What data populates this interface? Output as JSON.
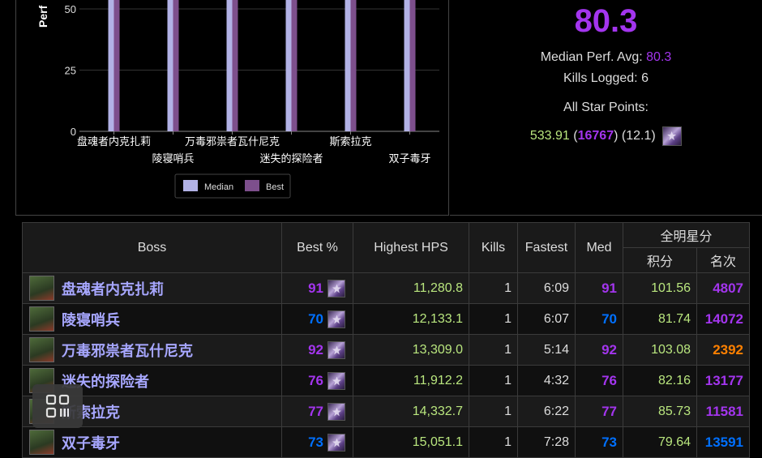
{
  "summary": {
    "big_score": "80.3",
    "median_label": "Median Perf. Avg:",
    "median_value": "80.3",
    "kills_label": "Kills Logged:",
    "kills_value": "6",
    "star_label": "All Star Points:",
    "star_points": "533.91",
    "star_rank": "16767",
    "star_pct": "(12.1)",
    "star_icon": "star-points-icon"
  },
  "chart_data": {
    "type": "bar",
    "ylabel": "Perf",
    "ylim": [
      0,
      100
    ],
    "yticks": [
      "0",
      "25",
      "50"
    ],
    "categories": [
      "盘魂者内克扎莉",
      "陵寝哨兵",
      "万毒邪祟者瓦什尼克",
      "迷失的探险者",
      "斯索拉克",
      "双子毒牙"
    ],
    "series": [
      {
        "name": "Median",
        "color": "#b2b2e6",
        "values": [
          91,
          70,
          92,
          76,
          77,
          73
        ]
      },
      {
        "name": "Best",
        "color": "#7d4f8c",
        "values": [
          91,
          70,
          92,
          76,
          77,
          73
        ]
      }
    ],
    "legend": "bottom"
  },
  "table": {
    "headers": {
      "boss": "Boss",
      "best": "Best %",
      "hps": "Highest HPS",
      "kills": "Kills",
      "fastest": "Fastest",
      "med": "Med",
      "allstar": "全明星分",
      "points": "积分",
      "rank": "名次"
    },
    "rows": [
      {
        "boss": "盘魂者内克扎莉",
        "best": "91",
        "best_tier": "purple",
        "hps": "11,280.8",
        "kills": "1",
        "fastest": "6:09",
        "med": "91",
        "med_tier": "purple",
        "points": "101.56",
        "rank": "4807",
        "rank_tier": "purple"
      },
      {
        "boss": "陵寝哨兵",
        "best": "70",
        "best_tier": "blue",
        "hps": "12,133.1",
        "kills": "1",
        "fastest": "6:07",
        "med": "70",
        "med_tier": "blue",
        "points": "81.74",
        "rank": "14072",
        "rank_tier": "purple"
      },
      {
        "boss": "万毒邪祟者瓦什尼克",
        "best": "92",
        "best_tier": "purple",
        "hps": "13,309.0",
        "kills": "1",
        "fastest": "5:14",
        "med": "92",
        "med_tier": "purple",
        "points": "103.08",
        "rank": "2392",
        "rank_tier": "orange"
      },
      {
        "boss": "迷失的探险者",
        "best": "76",
        "best_tier": "purple",
        "hps": "11,912.2",
        "kills": "1",
        "fastest": "4:32",
        "med": "76",
        "med_tier": "purple",
        "points": "82.16",
        "rank": "13177",
        "rank_tier": "purple"
      },
      {
        "boss": "斯索拉克",
        "best": "77",
        "best_tier": "purple",
        "hps": "14,332.7",
        "kills": "1",
        "fastest": "6:22",
        "med": "77",
        "med_tier": "purple",
        "points": "85.73",
        "rank": "11581",
        "rank_tier": "purple"
      },
      {
        "boss": "双子毒牙",
        "best": "73",
        "best_tier": "blue",
        "hps": "15,051.1",
        "kills": "1",
        "fastest": "7:28",
        "med": "73",
        "med_tier": "blue",
        "points": "79.64",
        "rank": "13591",
        "rank_tier": "blue"
      }
    ]
  },
  "overlay": {
    "icon": "qr-code-icon"
  }
}
